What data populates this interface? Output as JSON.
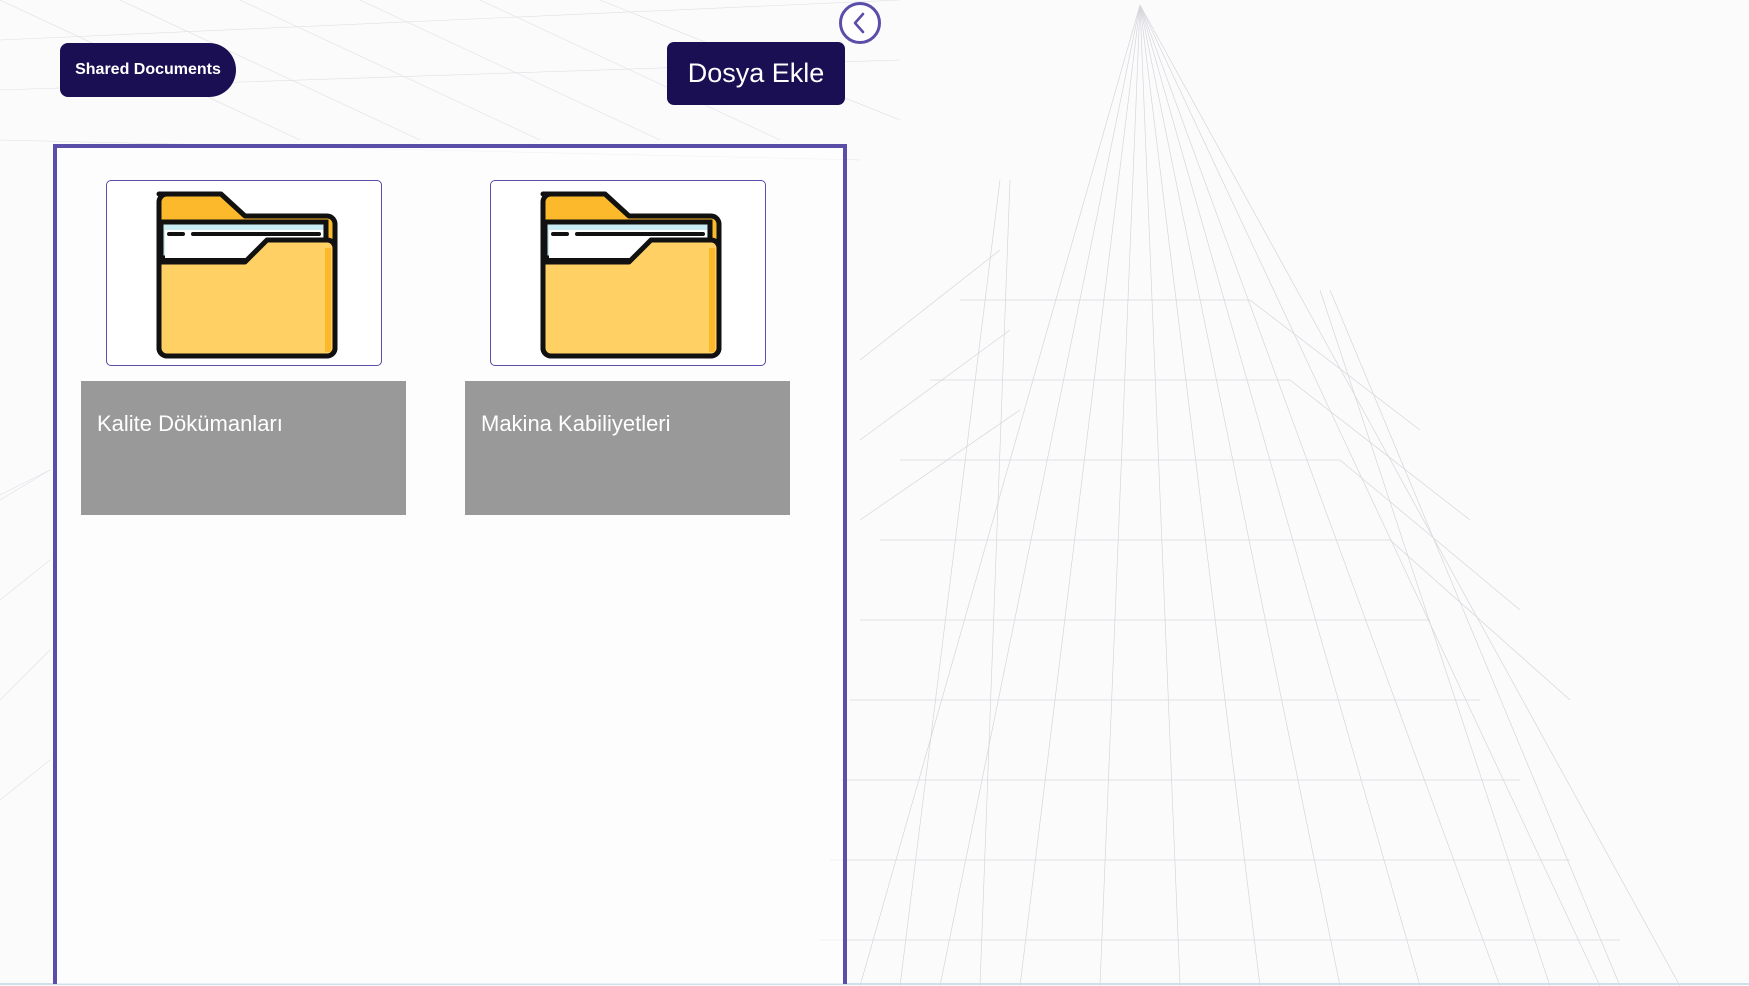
{
  "header": {
    "shared_label": "Shared Documents",
    "add_button_label": "Dosya Ekle",
    "back_icon": "chevron-left-icon"
  },
  "folders": [
    {
      "label": "Kalite Dökümanları",
      "icon": "folder-icon"
    },
    {
      "label": "Makina Kabiliyetleri",
      "icon": "folder-icon"
    }
  ],
  "colors": {
    "primary": "#1b0f54",
    "accent": "#5a4ea8",
    "label_bg": "#999999",
    "folder_body": "#ffd064",
    "folder_back": "#fdb92c",
    "folder_paper": "#c9ecf5"
  }
}
